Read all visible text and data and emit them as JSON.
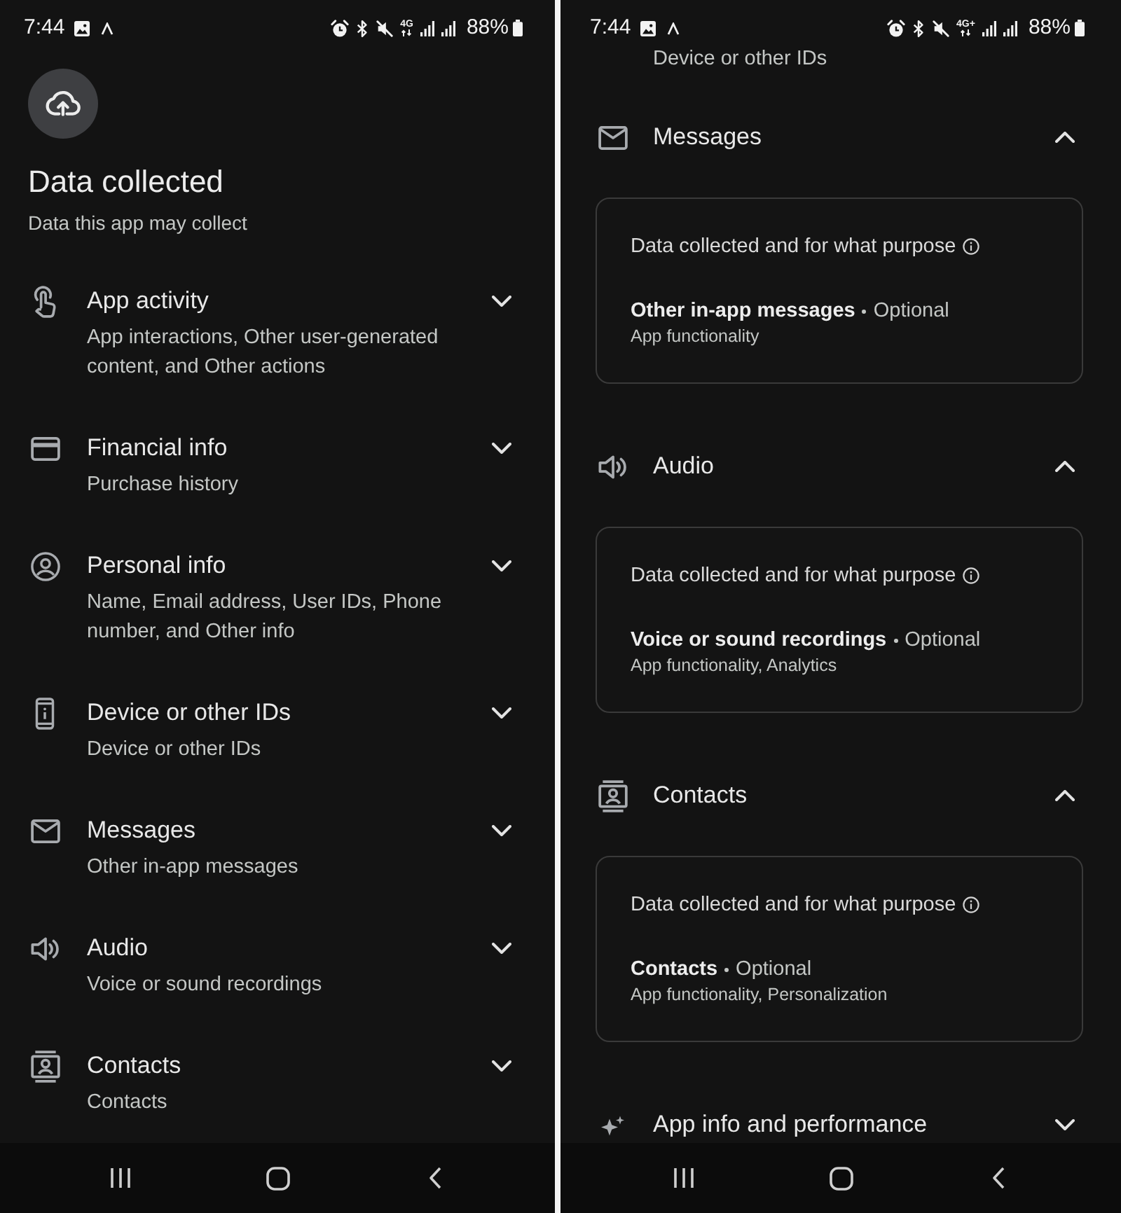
{
  "screens": [
    {
      "status_bar": {
        "time": "7:44",
        "network": "4G",
        "battery": "88%"
      },
      "header": {
        "title": "Data collected",
        "subtitle": "Data this app may collect"
      },
      "categories": [
        {
          "kind": "app-activity",
          "title": "App activity",
          "description": "App interactions, Other user-generated content, and Other actions",
          "expanded": false
        },
        {
          "kind": "financial",
          "title": "Financial info",
          "description": "Purchase history",
          "expanded": false
        },
        {
          "kind": "personal",
          "title": "Personal info",
          "description": "Name, Email address, User IDs, Phone number, and Other info",
          "expanded": false
        },
        {
          "kind": "device",
          "title": "Device or other IDs",
          "description": "Device or other IDs",
          "expanded": false
        },
        {
          "kind": "messages",
          "title": "Messages",
          "description": "Other in-app messages",
          "expanded": false
        },
        {
          "kind": "audio",
          "title": "Audio",
          "description": "Voice or sound recordings",
          "expanded": false
        },
        {
          "kind": "contacts",
          "title": "Contacts",
          "description": "Contacts",
          "expanded": false
        }
      ]
    },
    {
      "status_bar": {
        "time": "7:44",
        "network": "4G+",
        "battery": "88%"
      },
      "partial_description": "Device or other IDs",
      "categories": [
        {
          "kind": "messages",
          "title": "Messages",
          "expanded": true,
          "card": {
            "heading": "Data collected and for what purpose",
            "items": [
              {
                "name": "Other in-app messages",
                "requirement": "Optional",
                "purposes": "App functionality"
              }
            ]
          }
        },
        {
          "kind": "audio",
          "title": "Audio",
          "expanded": true,
          "card": {
            "heading": "Data collected and for what purpose",
            "items": [
              {
                "name": "Voice or sound recordings",
                "requirement": "Optional",
                "purposes": "App functionality, Analytics"
              }
            ]
          }
        },
        {
          "kind": "contacts",
          "title": "Contacts",
          "expanded": true,
          "card": {
            "heading": "Data collected and for what purpose",
            "items": [
              {
                "name": "Contacts",
                "requirement": "Optional",
                "purposes": "App functionality, Personalization"
              }
            ]
          }
        },
        {
          "kind": "app-info",
          "title": "App info and performance",
          "expanded": false
        }
      ]
    }
  ]
}
